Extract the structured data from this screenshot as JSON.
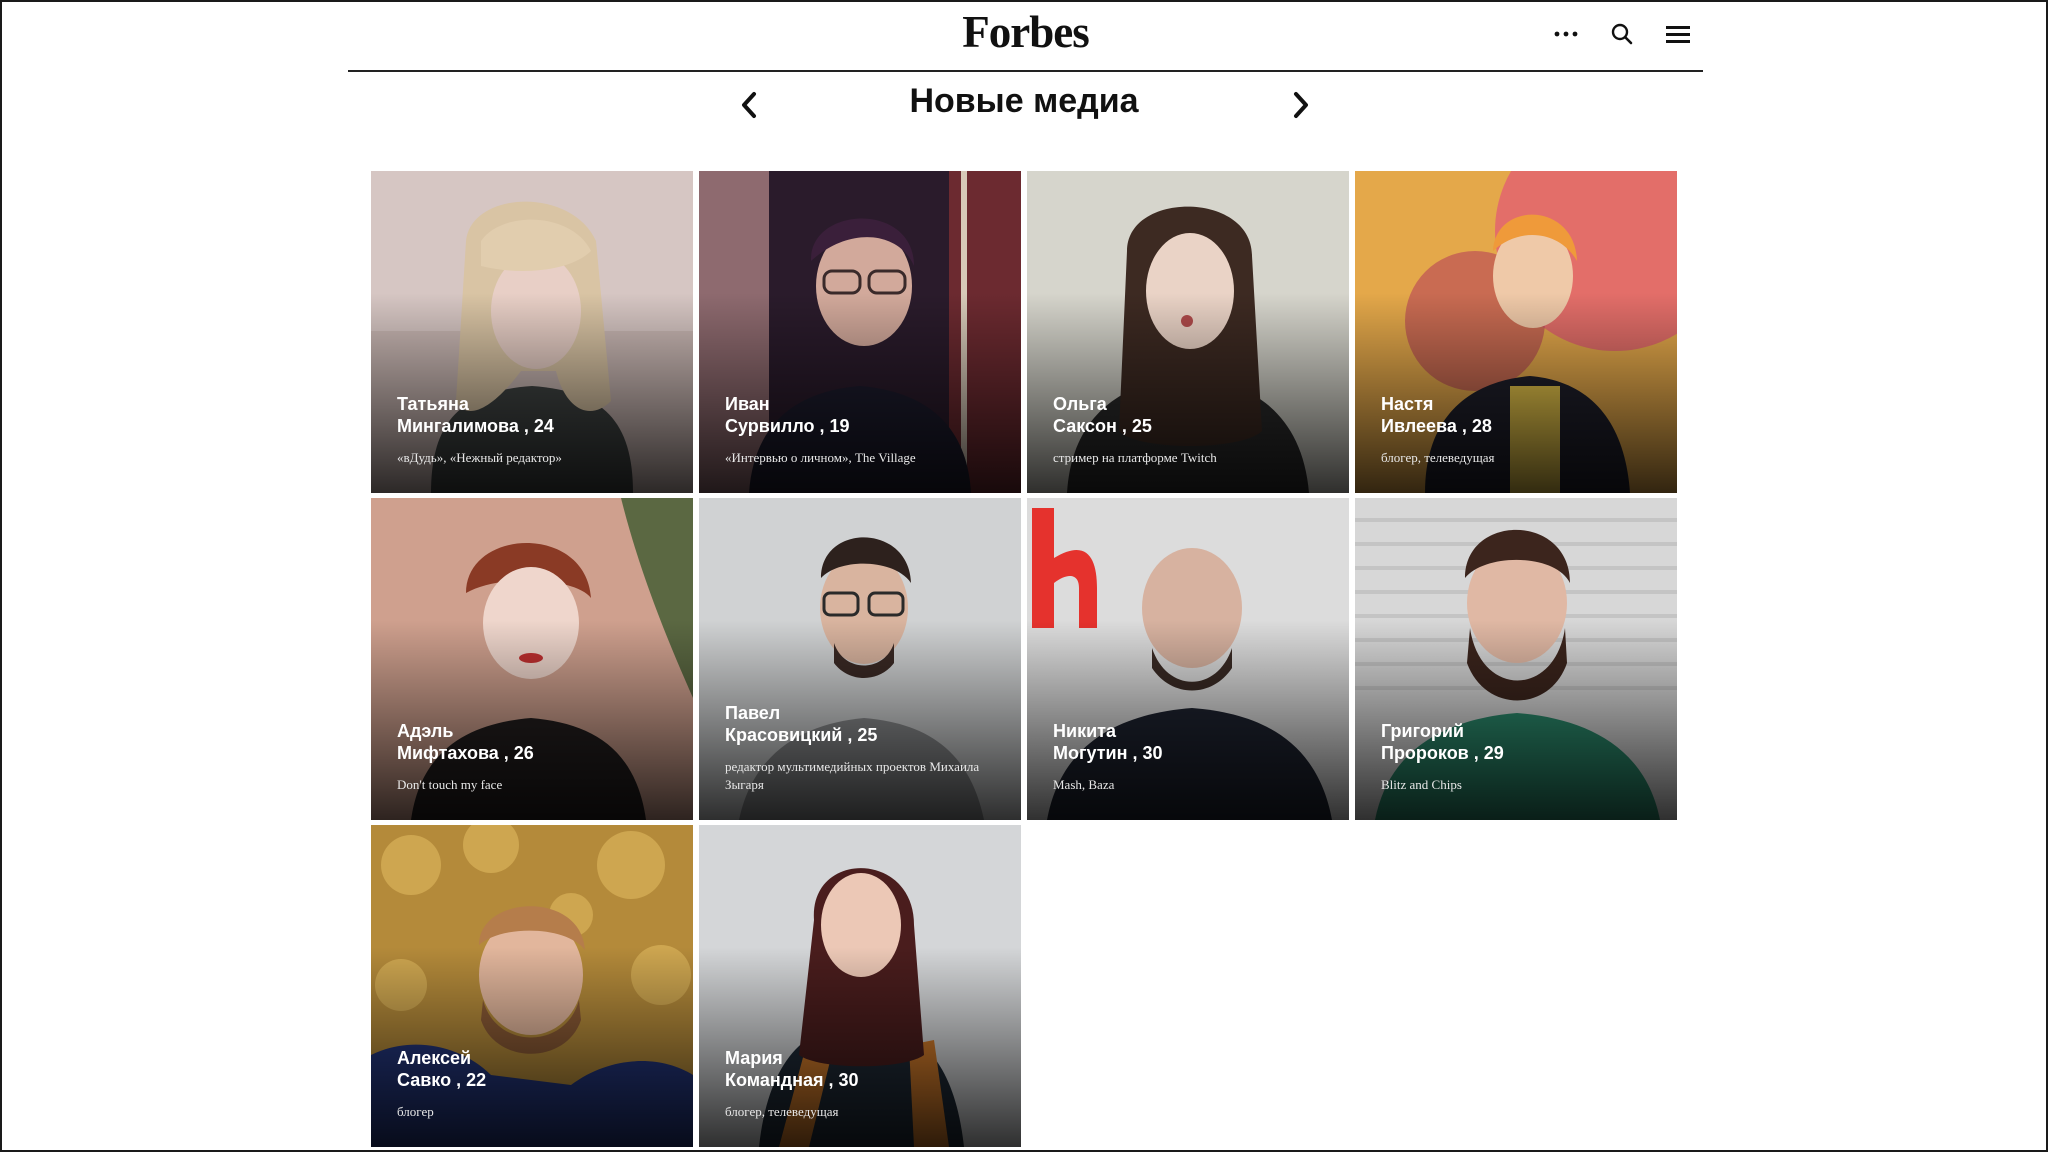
{
  "header": {
    "logo": "Forbes",
    "icons": [
      "more-icon",
      "search-icon",
      "menu-icon"
    ]
  },
  "section": {
    "title": "Новые медиа"
  },
  "people": [
    {
      "first": "Татьяна",
      "rest": "Мингалимова , 24",
      "desc": "«вДудь», «Нежный редактор»"
    },
    {
      "first": "Иван",
      "rest": "Сурвилло , 19",
      "desc": "«Интервью о личном», The Village"
    },
    {
      "first": "Ольга",
      "rest": "Саксон , 25",
      "desc": "стример на платформе Twitch"
    },
    {
      "first": "Настя",
      "rest": "Ивлеева , 28",
      "desc": "блогер, телеведущая"
    },
    {
      "first": "Адэль",
      "rest": "Мифтахова , 26",
      "desc": "Don't touch my face"
    },
    {
      "first": "Павел",
      "rest": "Красовицкий , 25",
      "desc": "редактор мультимедийных проектов Михаила Зыгаря"
    },
    {
      "first": "Никита",
      "rest": "Могутин , 30",
      "desc": "Mash, Baza"
    },
    {
      "first": "Григорий",
      "rest": "Пророков , 29",
      "desc": "Blitz and Chips"
    },
    {
      "first": "Алексей",
      "rest": "Савко , 22",
      "desc": "блогер"
    },
    {
      "first": "Мария",
      "rest": "Командная , 30",
      "desc": "блогер, телеведущая"
    }
  ],
  "colors": {
    "text": "#111111",
    "rule": "#222222"
  }
}
